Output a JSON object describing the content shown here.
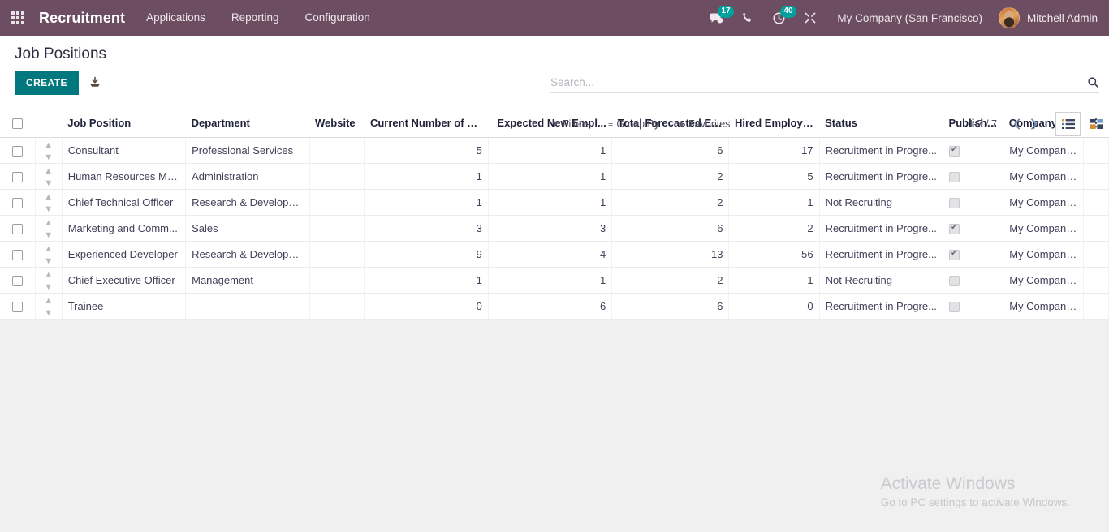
{
  "navbar": {
    "apps_icon": "apps-grid-icon",
    "brand": "Recruitment",
    "menu": [
      {
        "label": "Applications"
      },
      {
        "label": "Reporting"
      },
      {
        "label": "Configuration"
      }
    ],
    "messages_badge": "17",
    "activities_badge": "40",
    "company": "My Company (San Francisco)",
    "user": "Mitchell Admin",
    "bg_color": "#6d4d61"
  },
  "control_panel": {
    "title": "Job Positions",
    "create_label": "CREATE",
    "import_icon": "import-download-icon",
    "accent_color": "#00787d"
  },
  "search": {
    "placeholder": "Search...",
    "value": "",
    "icon": "search-icon"
  },
  "filters": {
    "filters_label": "Filters",
    "group_by_label": "Group By",
    "favorites_label": "Favorites"
  },
  "pager": {
    "count": "1-7 / 7",
    "prev_icon": "chevron-left-icon",
    "next_icon": "chevron-right-icon"
  },
  "views": {
    "list_icon": "list-view-icon",
    "kanban_icon": "kanban-view-icon",
    "active": "list"
  },
  "table": {
    "columns": [
      "Job Position",
      "Department",
      "Website",
      "Current Number of E...",
      "Expected New Empl...",
      "Total Forecasted Em...",
      "Hired Employees",
      "Status",
      "Published",
      "Company"
    ],
    "options_icon": "vertical-dots-icon",
    "rows": [
      {
        "job_position": "Consultant",
        "department": "Professional Services",
        "website": "",
        "current": "5",
        "expected": "1",
        "forecasted": "6",
        "hired": "17",
        "status": "Recruitment in Progre...",
        "published": true,
        "company": "My Company (San Fr..."
      },
      {
        "job_position": "Human Resources Ma...",
        "department": "Administration",
        "website": "",
        "current": "1",
        "expected": "1",
        "forecasted": "2",
        "hired": "5",
        "status": "Recruitment in Progre...",
        "published": false,
        "company": "My Company (San Fr..."
      },
      {
        "job_position": "Chief Technical Officer",
        "department": "Research & Developm...",
        "website": "",
        "current": "1",
        "expected": "1",
        "forecasted": "2",
        "hired": "1",
        "status": "Not Recruiting",
        "published": false,
        "company": "My Company (San Fr..."
      },
      {
        "job_position": "Marketing and Comm...",
        "department": "Sales",
        "website": "",
        "current": "3",
        "expected": "3",
        "forecasted": "6",
        "hired": "2",
        "status": "Recruitment in Progre...",
        "published": true,
        "company": "My Company (San Fr..."
      },
      {
        "job_position": "Experienced Developer",
        "department": "Research & Developm...",
        "website": "",
        "current": "9",
        "expected": "4",
        "forecasted": "13",
        "hired": "56",
        "status": "Recruitment in Progre...",
        "published": true,
        "company": "My Company (San Fr..."
      },
      {
        "job_position": "Chief Executive Officer",
        "department": "Management",
        "website": "",
        "current": "1",
        "expected": "1",
        "forecasted": "2",
        "hired": "1",
        "status": "Not Recruiting",
        "published": false,
        "company": "My Company (San Fr..."
      },
      {
        "job_position": "Trainee",
        "department": "",
        "website": "",
        "current": "0",
        "expected": "6",
        "forecasted": "6",
        "hired": "0",
        "status": "Recruitment in Progre...",
        "published": false,
        "company": "My Company (San Fr..."
      }
    ]
  },
  "watermark": {
    "line1": "Activate Windows",
    "line2": "Go to PC settings to activate Windows."
  }
}
